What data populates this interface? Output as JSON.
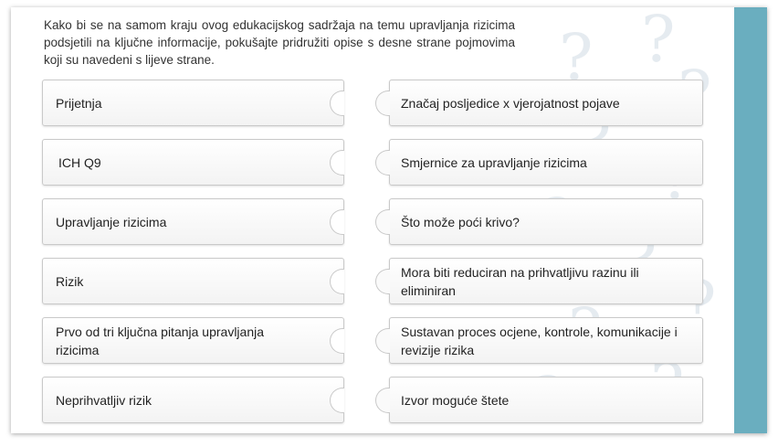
{
  "instructions": "Kako bi se na samom kraju ovog edukacijskog sadržaja na temu upravljanja rizicima podsjetili na ključne informacije, pokušajte pridružiti opise s desne strane pojmovima koji su navedeni s lijeve strane.",
  "terms": [
    "Prijetnja",
    "ICH Q9",
    "Upravljanje rizicima",
    "Rizik",
    "Prvo od tri ključna pitanja upravljanja rizicima",
    "Neprihvatljiv rizik"
  ],
  "descriptions": [
    "Značaj posljedice x vjerojatnost pojave",
    "Smjernice za upravljanje rizicima",
    "Što može poći krivo?",
    "Mora biti reduciran na prihvatljivu razinu ili eliminiran",
    "Sustavan proces ocjene, kontrole, komunikacije i revizije rizika",
    "Izvor moguće štete"
  ],
  "colors": {
    "accent_bar": "#6aaebf",
    "card_border": "#c9c9c9",
    "text": "#222222"
  },
  "decoration": "question-mark-pattern"
}
